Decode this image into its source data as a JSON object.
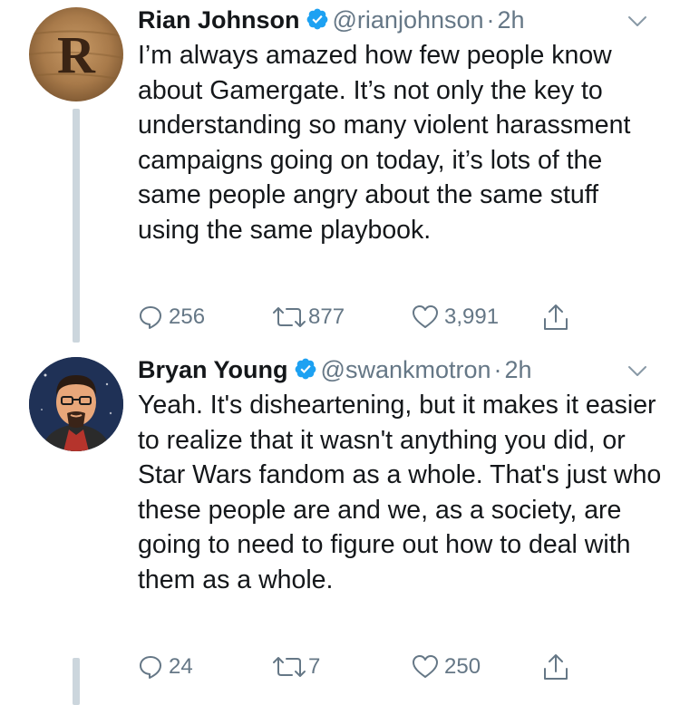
{
  "tweets": [
    {
      "author_name": "Rian Johnson",
      "handle": "@rianjohnson",
      "separator": "·",
      "time": "2h",
      "avatar_letter": "R",
      "text": "I’m always amazed how few people know about Gamergate. It’s not only the key to understanding so many violent harassment campaigns going on today, it’s lots of the same people angry about the same stuff using the same playbook.",
      "replies": "256",
      "retweets": "877",
      "likes": "3,991"
    },
    {
      "author_name": "Bryan Young",
      "handle": "@swankmotron",
      "separator": "·",
      "time": "2h",
      "text": "Yeah. It's disheartening, but it makes it easier to realize that it wasn't anything you did, or Star Wars fandom as a whole. That's just who these people are and we, as a society, are going to need to figure out how to deal with them as a whole.",
      "replies": "24",
      "retweets": "7",
      "likes": "250"
    }
  ],
  "icons": {
    "verified": "verified-badge-icon",
    "caret": "chevron-down-icon",
    "reply": "reply-bubble-icon",
    "retweet": "retweet-icon",
    "like": "heart-icon",
    "share": "share-upload-icon"
  },
  "colors": {
    "text": "#14171a",
    "secondary": "#657786",
    "verified": "#1da1f2",
    "thread_line": "#ccd6dd"
  }
}
